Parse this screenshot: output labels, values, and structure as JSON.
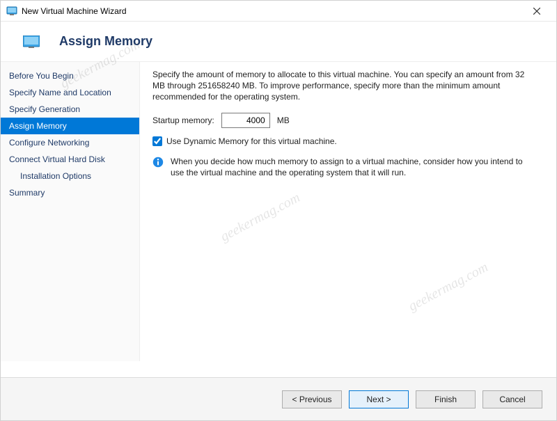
{
  "titlebar": {
    "title": "New Virtual Machine Wizard"
  },
  "header": {
    "title": "Assign Memory"
  },
  "sidebar": {
    "items": [
      {
        "label": "Before You Begin",
        "indent": false
      },
      {
        "label": "Specify Name and Location",
        "indent": false
      },
      {
        "label": "Specify Generation",
        "indent": false
      },
      {
        "label": "Assign Memory",
        "indent": false,
        "selected": true
      },
      {
        "label": "Configure Networking",
        "indent": false
      },
      {
        "label": "Connect Virtual Hard Disk",
        "indent": false
      },
      {
        "label": "Installation Options",
        "indent": true
      },
      {
        "label": "Summary",
        "indent": false
      }
    ]
  },
  "main": {
    "description": "Specify the amount of memory to allocate to this virtual machine. You can specify an amount from 32 MB through 251658240 MB. To improve performance, specify more than the minimum amount recommended for the operating system.",
    "startup_label": "Startup memory:",
    "startup_value": "4000",
    "startup_unit": "MB",
    "dynamic_checkbox_label": "Use Dynamic Memory for this virtual machine.",
    "dynamic_checked": true,
    "info_text": "When you decide how much memory to assign to a virtual machine, consider how you intend to use the virtual machine and the operating system that it will run."
  },
  "footer": {
    "previous": "< Previous",
    "next": "Next >",
    "finish": "Finish",
    "cancel": "Cancel"
  },
  "watermark_text": "geekermag.com"
}
